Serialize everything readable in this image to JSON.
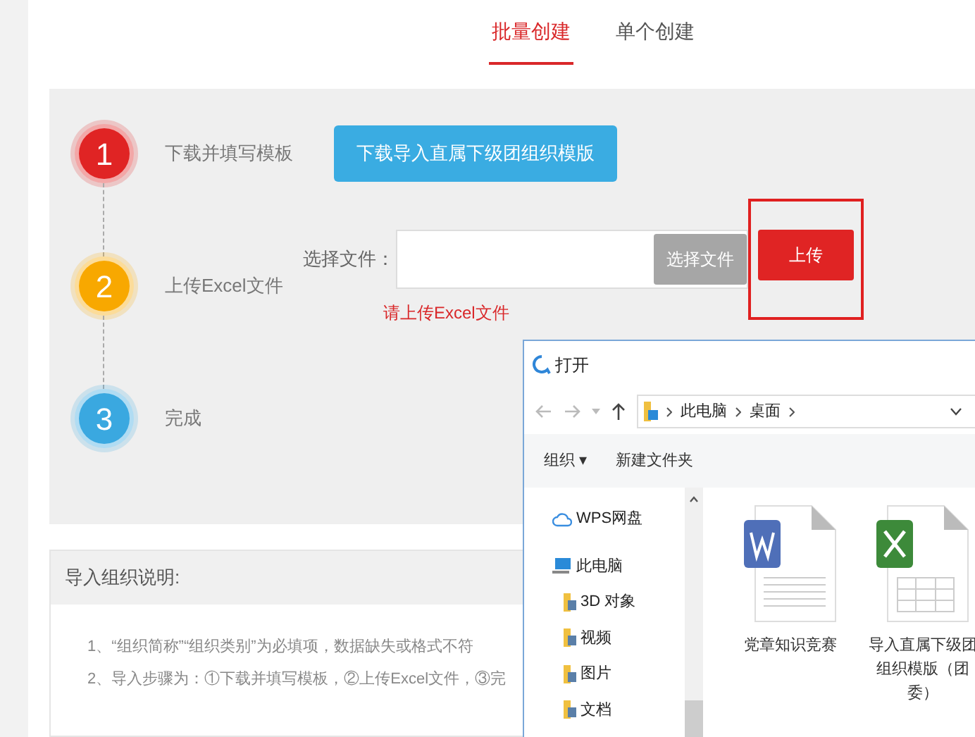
{
  "tabs": [
    {
      "label": "批量创建",
      "selected": true
    },
    {
      "label": "单个创建",
      "selected": false
    }
  ],
  "steps": [
    {
      "number": "1",
      "label": "下载并填写模板",
      "color": "#e02424"
    },
    {
      "number": "2",
      "label": "上传Excel文件",
      "color": "#f8a800"
    },
    {
      "number": "3",
      "label": "完成",
      "color": "#3aa8e0"
    }
  ],
  "download_button": "下载导入直属下级团组织模版",
  "file_picker": {
    "label": "选择文件：",
    "browse_button": "选择文件",
    "upload_button": "上传",
    "upload_highlighted": true,
    "hint": "请上传Excel文件"
  },
  "instructions": {
    "title": "导入组织说明:",
    "lines": [
      "1、“组织简称”“组织类别”为必填项，数据缺失或格式不符",
      "2、导入步骤为：①下载并填写模板，②上传Excel文件，③完"
    ]
  },
  "dialog": {
    "title": "打开",
    "breadcrumb": [
      "此电脑",
      "桌面"
    ],
    "toolbar": [
      "组织 ▾",
      "新建文件夹"
    ],
    "nav": [
      {
        "label": "WPS网盘",
        "kind": "cloud"
      },
      {
        "label": "此电脑",
        "kind": "pc",
        "children": [
          {
            "label": "3D 对象",
            "kind": "folder"
          },
          {
            "label": "视频",
            "kind": "folder"
          },
          {
            "label": "图片",
            "kind": "folder"
          },
          {
            "label": "文档",
            "kind": "folder"
          }
        ]
      }
    ],
    "files": [
      {
        "name": "党章知识竞赛",
        "kind": "word"
      },
      {
        "name": "导入直属下级团组织模版（团委）",
        "kind": "excel"
      }
    ]
  }
}
